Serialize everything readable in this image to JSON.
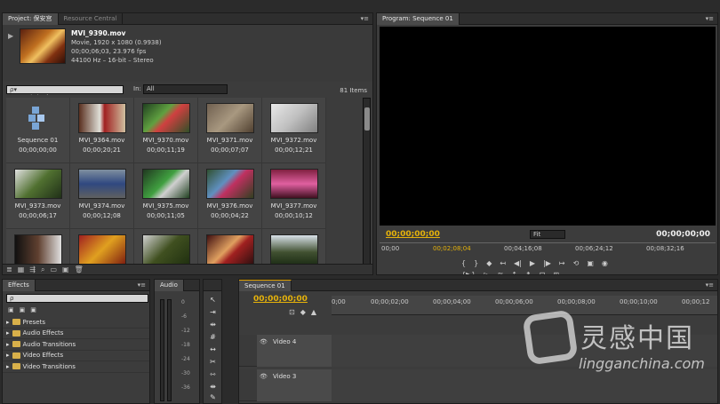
{
  "project": {
    "tabs": [
      "Project: 保安宫",
      "Resource Central"
    ],
    "clip": {
      "name": "MVI_9390.mov",
      "line1": "Movie, 1920 x 1080 (0.9938)",
      "line2": "00;00;06;03, 23.976 fps",
      "line3": "44100 Hz – 16-bit – Stereo"
    },
    "file": "保安宫.prproj",
    "items": "81 Items",
    "search_placeholder": "ρ▾",
    "in_label": "In:",
    "in_value": "All",
    "cells": [
      {
        "name": "Sequence 01",
        "dur": "00;00;00;00"
      },
      {
        "name": "MVI_9364.mov",
        "dur": "00;00;20;21"
      },
      {
        "name": "MVI_9370.mov",
        "dur": "00;00;11;19"
      },
      {
        "name": "MVI_9371.mov",
        "dur": "00;00;07;07"
      },
      {
        "name": "MVI_9372.mov",
        "dur": "00;00;12;21"
      },
      {
        "name": "MVI_9373.mov",
        "dur": "00;00;06;17"
      },
      {
        "name": "MVI_9374.mov",
        "dur": "00;00;12;08"
      },
      {
        "name": "MVI_9375.mov",
        "dur": "00;00;11;05"
      },
      {
        "name": "MVI_9376.mov",
        "dur": "00;00;04;22"
      },
      {
        "name": "MVI_9377.mov",
        "dur": "00;00;10;12"
      },
      {
        "name": "",
        "dur": ""
      },
      {
        "name": "",
        "dur": ""
      },
      {
        "name": "",
        "dur": ""
      },
      {
        "name": "",
        "dur": ""
      },
      {
        "name": "",
        "dur": ""
      }
    ]
  },
  "program": {
    "tab": "Program: Sequence 01",
    "tc_current": "00;00;00;00",
    "tc_duration": "00;00;00;00",
    "fit": "Fit",
    "ruler": [
      "00;00",
      "00;02;08;04",
      "00;04;16;08",
      "00;06;24;12",
      "00;08;32;16"
    ]
  },
  "effects": {
    "tab": "Effects",
    "items": [
      "Presets",
      "Audio Effects",
      "Audio Transitions",
      "Video Effects",
      "Video Transitions"
    ]
  },
  "audio": {
    "tab": "Audio",
    "db": [
      "0",
      "-6",
      "-12",
      "-18",
      "-24",
      "-30",
      "-36"
    ]
  },
  "timeline": {
    "tab": "Sequence 01",
    "tc": "00;00;00;00",
    "ruler": [
      "0;00",
      "00;00;02;00",
      "00;00;04;00",
      "00;00;06;00",
      "00;00;08;00",
      "00;00;10;00",
      "00;00;12"
    ],
    "tracks": [
      "Video 4",
      "Video 3"
    ]
  },
  "watermark": {
    "cn": "灵感中国",
    "en": "lingganchina.com"
  }
}
